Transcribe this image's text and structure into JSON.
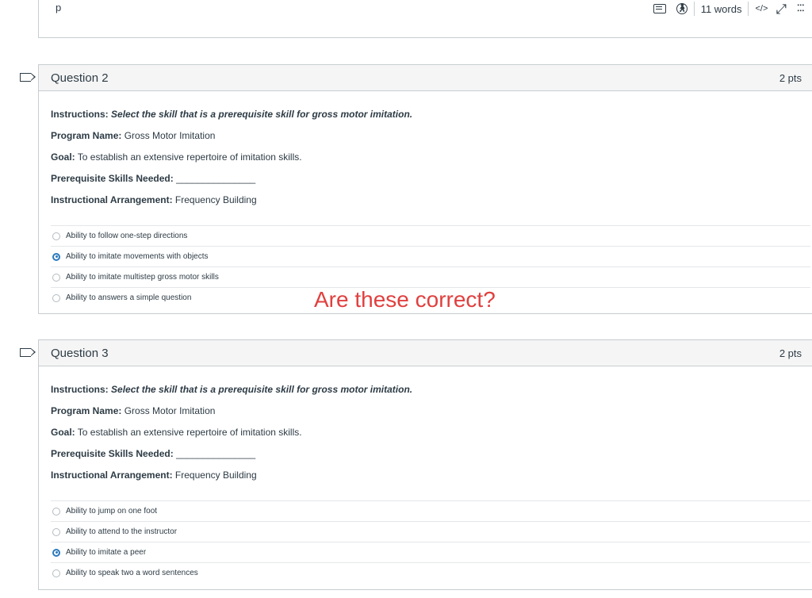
{
  "editor": {
    "paragraph_tag": "p",
    "word_count": "11 words",
    "html_toggle": "</>"
  },
  "icons": {
    "keyboard": "keyboard-icon",
    "accessibility": "accessibility-icon",
    "expand": "expand-icon",
    "drag": "drag-handle-icon",
    "flag": "flag-icon"
  },
  "questions": [
    {
      "title": "Question 2",
      "points": "2 pts",
      "instructions_label": "Instructions:",
      "instructions_text": "Select the skill that is a prerequisite skill for gross motor imitation.",
      "program_label": "Program Name:",
      "program_value": "Gross Motor Imitation",
      "goal_label": "Goal:",
      "goal_value": "To establish an extensive repertoire of imitation skills.",
      "prereq_label": "Prerequisite Skills Needed:",
      "prereq_value": "_______________",
      "arrangement_label": "Instructional Arrangement:",
      "arrangement_value": "Frequency Building",
      "answers": [
        {
          "label": "Ability to follow one-step directions",
          "selected": false
        },
        {
          "label": "Ability to imitate movements with objects",
          "selected": true
        },
        {
          "label": "Ability to imitate multistep gross motor skills",
          "selected": false
        },
        {
          "label": "Ability to answers a simple question",
          "selected": false
        }
      ]
    },
    {
      "title": "Question 3",
      "points": "2 pts",
      "instructions_label": "Instructions:",
      "instructions_text": "Select the skill that is a prerequisite skill for gross motor imitation.",
      "program_label": "Program Name:",
      "program_value": "Gross Motor Imitation",
      "goal_label": "Goal:",
      "goal_value": "To establish an extensive repertoire of imitation skills.",
      "prereq_label": "Prerequisite Skills Needed:",
      "prereq_value": "_______________",
      "arrangement_label": "Instructional Arrangement:",
      "arrangement_value": "Frequency Building",
      "answers": [
        {
          "label": "Ability to jump on one foot",
          "selected": false
        },
        {
          "label": "Ability to attend to the instructor",
          "selected": false
        },
        {
          "label": "Ability to imitate a peer",
          "selected": true
        },
        {
          "label": "Ability to speak two a word sentences",
          "selected": false
        }
      ]
    }
  ],
  "annotation": {
    "text": "Are these correct?",
    "color": "#e0403f"
  },
  "colors": {
    "accent": "#2b7abc",
    "border": "#c7cdd1",
    "header_bg": "#f5f5f5",
    "text": "#2d3b45"
  }
}
